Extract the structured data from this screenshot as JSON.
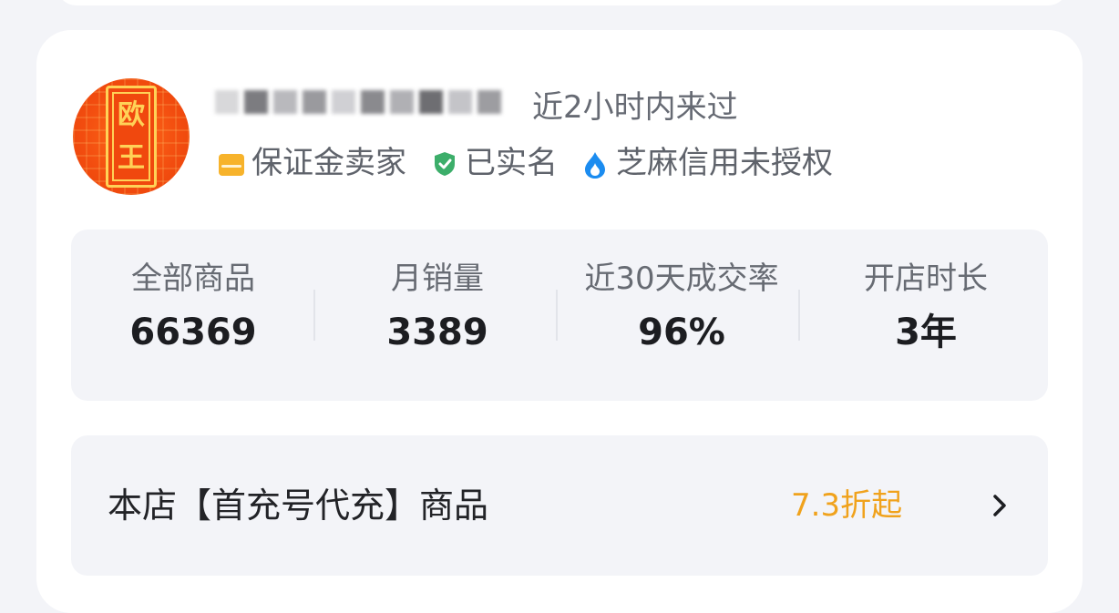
{
  "shop": {
    "avatar_text": [
      "欧",
      "王"
    ],
    "last_seen": "近2小时内来过",
    "badges": [
      {
        "icon": "seller-deposit-icon",
        "label": "保证金卖家",
        "color": "#f7b32b"
      },
      {
        "icon": "verified-shield-icon",
        "label": "已实名",
        "color": "#3cae6a"
      },
      {
        "icon": "sesame-credit-icon",
        "label": "芝麻信用未授权",
        "color": "#1b8cf0"
      }
    ]
  },
  "stats": [
    {
      "label": "全部商品",
      "value": "66369"
    },
    {
      "label": "月销量",
      "value": "3389"
    },
    {
      "label": "近30天成交率",
      "value": "96%"
    },
    {
      "label": "开店时长",
      "value": "3年"
    }
  ],
  "promo": {
    "label": "本店【首充号代充】商品",
    "discount": "7.3折起",
    "accent_color": "#f0a21c"
  }
}
